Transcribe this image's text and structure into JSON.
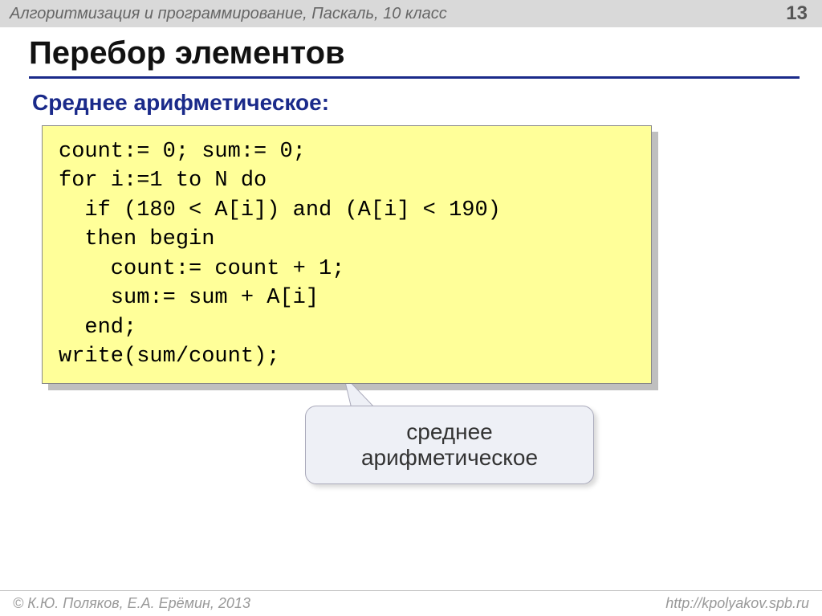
{
  "topbar": {
    "course": "Алгоритмизация и программирование, Паскаль, 10 класс",
    "page": "13"
  },
  "title": "Перебор элементов",
  "subtitle": "Среднее арифметическое:",
  "code": "count:= 0; sum:= 0;\nfor i:=1 to N do\n  if (180 < A[i]) and (A[i] < 190)\n  then begin\n    count:= count + 1;\n    sum:= sum + A[i]\n  end;\nwrite(sum/count);",
  "callout": "среднее\nарифметическое",
  "footer": {
    "left": "© К.Ю. Поляков, Е.А. Ерёмин, 2013",
    "right": "http://kpolyakov.spb.ru"
  }
}
